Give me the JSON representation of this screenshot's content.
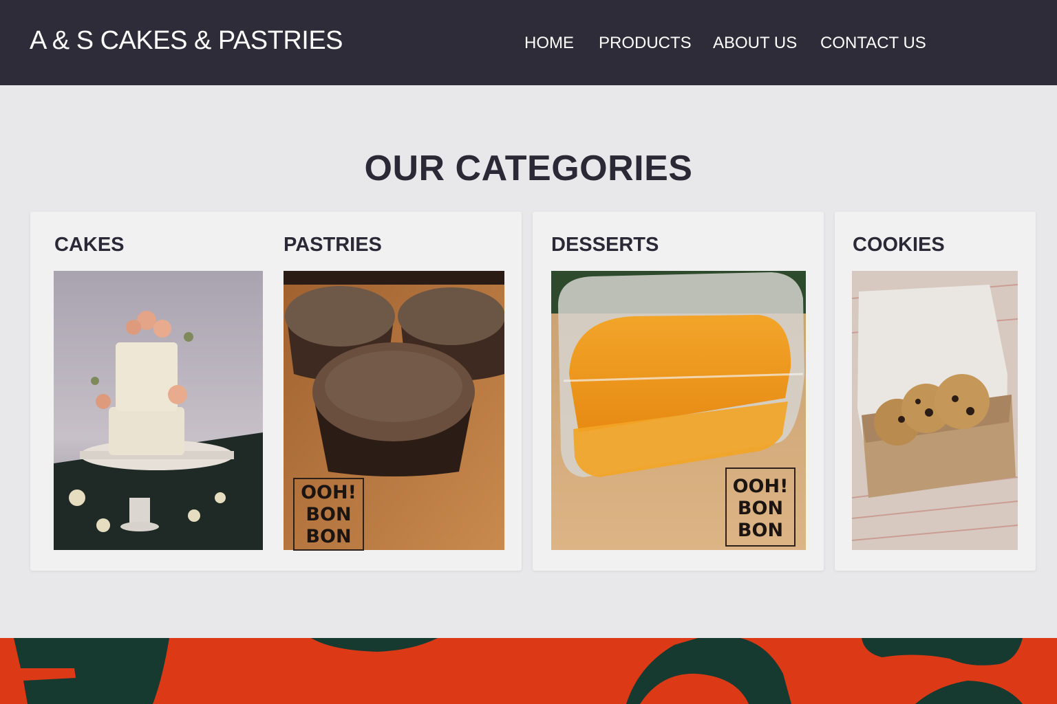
{
  "header": {
    "brand": "A & S CAKES & PASTRIES",
    "nav": [
      "HOME",
      "PRODUCTS",
      "ABOUT US",
      "CONTACT US"
    ]
  },
  "main": {
    "title": "OUR CATEGORIES",
    "categories": [
      {
        "label": "CAKES",
        "image": "two-tier-cake-photo"
      },
      {
        "label": "PASTRIES",
        "image": "muffins-photo",
        "stamp": [
          "OOH!",
          "BON",
          "BON"
        ]
      },
      {
        "label": "DESSERTS",
        "image": "mango-dessert-photo",
        "stamp": [
          "OOH!",
          "BON",
          "BON"
        ]
      },
      {
        "label": "COOKIES",
        "image": "cookies-box-photo"
      }
    ]
  },
  "colors": {
    "header_bg": "#2d2c38",
    "page_bg": "#e8e8eb",
    "card_bg": "#f1f1f2",
    "heading": "#2a2935",
    "footer_red": "#dc3a17",
    "footer_dark": "#163a30"
  }
}
